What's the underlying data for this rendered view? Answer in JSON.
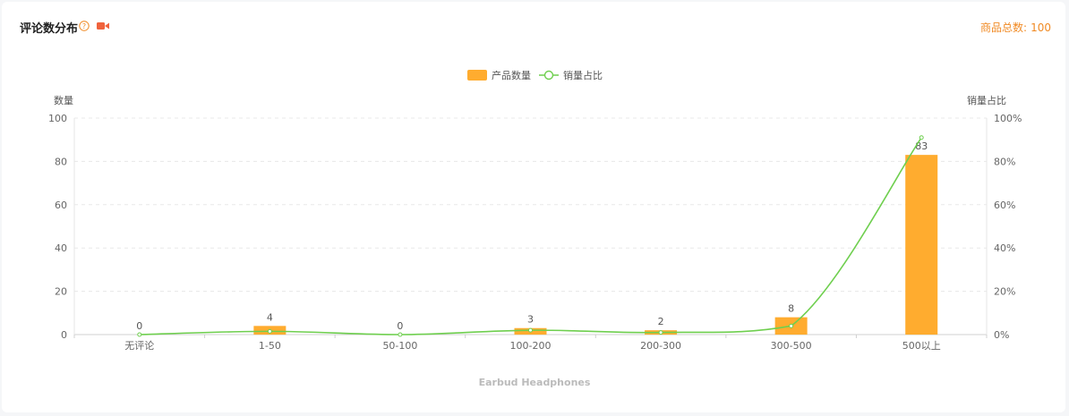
{
  "header": {
    "title": "评论数分布",
    "total_label": "商品总数:",
    "total_value": "100"
  },
  "colors": {
    "bar": "#ffac2f",
    "line": "#6fcf4f",
    "accent": "#f08a24",
    "video_icon": "#f0623c"
  },
  "icons": {
    "help": "help-circle-icon",
    "video": "video-camera-icon"
  },
  "chart_data": {
    "type": "bar",
    "categories": [
      "无评论",
      "1-50",
      "50-100",
      "100-200",
      "200-300",
      "300-500",
      "500以上"
    ],
    "series": [
      {
        "name": "产品数量",
        "type": "bar",
        "axis": "left",
        "values": [
          0,
          4,
          0,
          3,
          2,
          8,
          83
        ]
      },
      {
        "name": "销量占比",
        "type": "line",
        "axis": "right",
        "values": [
          0,
          1.5,
          0,
          2,
          1,
          4,
          91
        ]
      }
    ],
    "ylabel": "数量",
    "ylim": [
      0,
      100
    ],
    "yticks": [
      "0",
      "20",
      "40",
      "60",
      "80",
      "100"
    ],
    "y2label": "销量占比",
    "y2lim": [
      0,
      100
    ],
    "y2ticks": [
      "0%",
      "20%",
      "40%",
      "60%",
      "80%",
      "100%"
    ],
    "xlabel": "Earbud Headphones",
    "grid": true,
    "legend": "top-center"
  }
}
